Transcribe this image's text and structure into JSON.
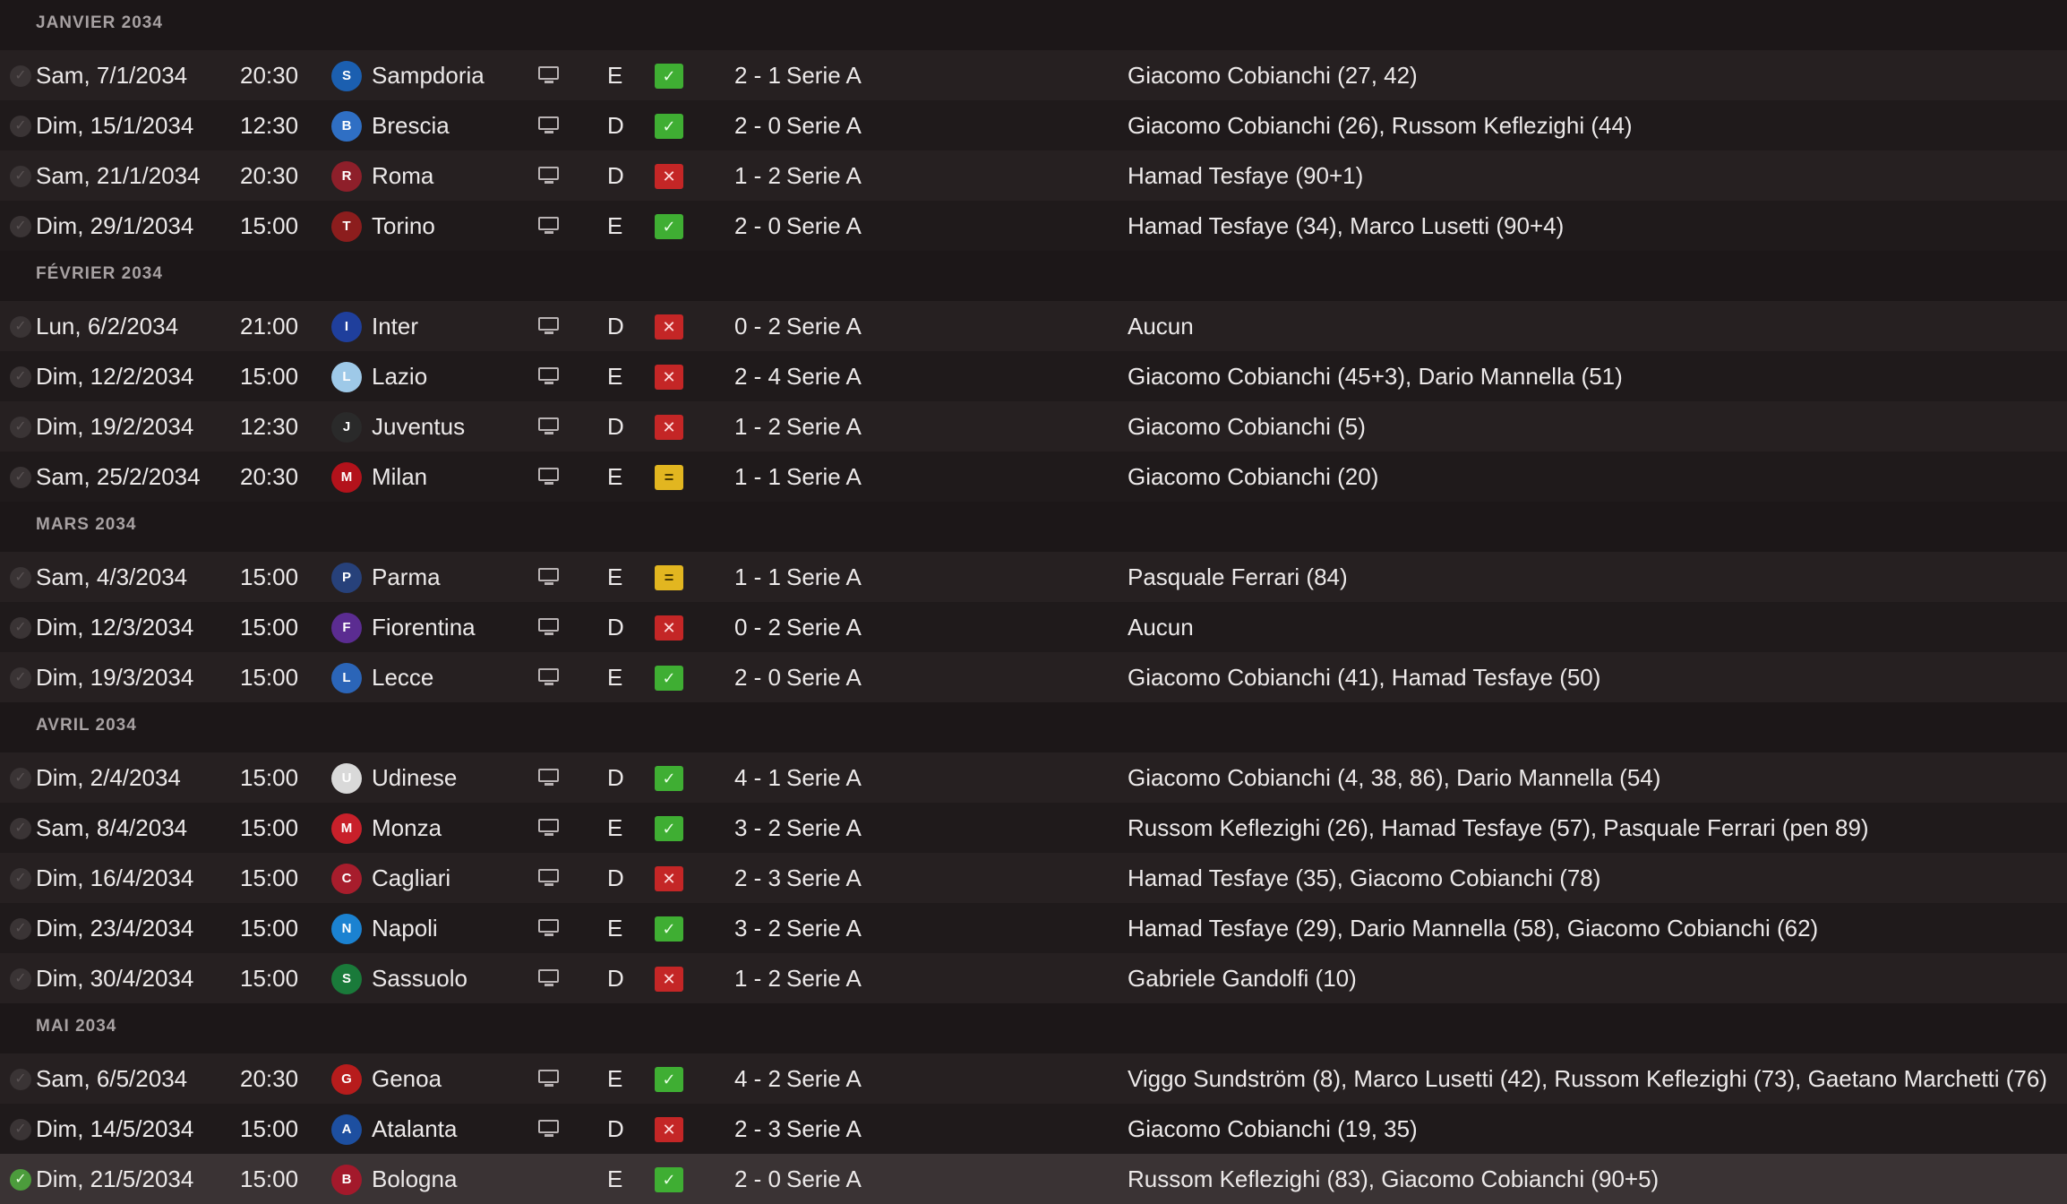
{
  "months": [
    {
      "label": "JANVIER 2034",
      "matches": [
        {
          "date": "Sam, 7/1/2034",
          "time": "20:30",
          "team": "Sampdoria",
          "crest_color": "#1b5fb0",
          "crest_glyph": "S",
          "tv": true,
          "venue": "E",
          "result": "w",
          "result_glyph": "✓",
          "score": "2 - 1",
          "competition": "Serie A",
          "scorers": "Giacomo Cobianchi (27, 42)"
        },
        {
          "date": "Dim, 15/1/2034",
          "time": "12:30",
          "team": "Brescia",
          "crest_color": "#2f6fc4",
          "crest_glyph": "B",
          "tv": true,
          "venue": "D",
          "result": "w",
          "result_glyph": "✓",
          "score": "2 - 0",
          "competition": "Serie A",
          "scorers": "Giacomo Cobianchi (26), Russom Keflezighi (44)"
        },
        {
          "date": "Sam, 21/1/2034",
          "time": "20:30",
          "team": "Roma",
          "crest_color": "#8e1f2a",
          "crest_glyph": "R",
          "tv": true,
          "venue": "D",
          "result": "l",
          "result_glyph": "✕",
          "score": "1 - 2",
          "competition": "Serie A",
          "scorers": "Hamad Tesfaye (90+1)"
        },
        {
          "date": "Dim, 29/1/2034",
          "time": "15:00",
          "team": "Torino",
          "crest_color": "#8c1d1d",
          "crest_glyph": "T",
          "tv": true,
          "venue": "E",
          "result": "w",
          "result_glyph": "✓",
          "score": "2 - 0",
          "competition": "Serie A",
          "scorers": "Hamad Tesfaye (34), Marco Lusetti (90+4)"
        }
      ]
    },
    {
      "label": "FÉVRIER 2034",
      "matches": [
        {
          "date": "Lun, 6/2/2034",
          "time": "21:00",
          "team": "Inter",
          "crest_color": "#1f3f9c",
          "crest_glyph": "I",
          "tv": true,
          "venue": "D",
          "result": "l",
          "result_glyph": "✕",
          "score": "0 - 2",
          "competition": "Serie A",
          "scorers": "Aucun"
        },
        {
          "date": "Dim, 12/2/2034",
          "time": "15:00",
          "team": "Lazio",
          "crest_color": "#9ec9e8",
          "crest_glyph": "L",
          "tv": true,
          "venue": "E",
          "result": "l",
          "result_glyph": "✕",
          "score": "2 - 4",
          "competition": "Serie A",
          "scorers": "Giacomo Cobianchi (45+3), Dario Mannella (51)"
        },
        {
          "date": "Dim, 19/2/2034",
          "time": "12:30",
          "team": "Juventus",
          "crest_color": "#2a2a2a",
          "crest_glyph": "J",
          "tv": true,
          "venue": "D",
          "result": "l",
          "result_glyph": "✕",
          "score": "1 - 2",
          "competition": "Serie A",
          "scorers": "Giacomo Cobianchi (5)"
        },
        {
          "date": "Sam, 25/2/2034",
          "time": "20:30",
          "team": "Milan",
          "crest_color": "#b3121b",
          "crest_glyph": "M",
          "tv": true,
          "venue": "E",
          "result": "d",
          "result_glyph": "=",
          "score": "1 - 1",
          "competition": "Serie A",
          "scorers": "Giacomo Cobianchi (20)"
        }
      ]
    },
    {
      "label": "MARS 2034",
      "matches": [
        {
          "date": "Sam, 4/3/2034",
          "time": "15:00",
          "team": "Parma",
          "crest_color": "#27417a",
          "crest_glyph": "P",
          "tv": true,
          "venue": "E",
          "result": "d",
          "result_glyph": "=",
          "score": "1 - 1",
          "competition": "Serie A",
          "scorers": "Pasquale Ferrari (84)"
        },
        {
          "date": "Dim, 12/3/2034",
          "time": "15:00",
          "team": "Fiorentina",
          "crest_color": "#5b2c91",
          "crest_glyph": "F",
          "tv": true,
          "venue": "D",
          "result": "l",
          "result_glyph": "✕",
          "score": "0 - 2",
          "competition": "Serie A",
          "scorers": "Aucun"
        },
        {
          "date": "Dim, 19/3/2034",
          "time": "15:00",
          "team": "Lecce",
          "crest_color": "#2b65b8",
          "crest_glyph": "L",
          "tv": true,
          "venue": "E",
          "result": "w",
          "result_glyph": "✓",
          "score": "2 - 0",
          "competition": "Serie A",
          "scorers": "Giacomo Cobianchi (41), Hamad Tesfaye (50)"
        }
      ]
    },
    {
      "label": "AVRIL 2034",
      "matches": [
        {
          "date": "Dim, 2/4/2034",
          "time": "15:00",
          "team": "Udinese",
          "crest_color": "#d9d9d9",
          "crest_glyph": "U",
          "tv": true,
          "venue": "D",
          "result": "w",
          "result_glyph": "✓",
          "score": "4 - 1",
          "competition": "Serie A",
          "scorers": "Giacomo Cobianchi (4, 38, 86), Dario Mannella (54)"
        },
        {
          "date": "Sam, 8/4/2034",
          "time": "15:00",
          "team": "Monza",
          "crest_color": "#c8202a",
          "crest_glyph": "M",
          "tv": true,
          "venue": "E",
          "result": "w",
          "result_glyph": "✓",
          "score": "3 - 2",
          "competition": "Serie A",
          "scorers": "Russom Keflezighi (26), Hamad Tesfaye (57), Pasquale Ferrari (pen 89)"
        },
        {
          "date": "Dim, 16/4/2034",
          "time": "15:00",
          "team": "Cagliari",
          "crest_color": "#a71d2c",
          "crest_glyph": "C",
          "tv": true,
          "venue": "D",
          "result": "l",
          "result_glyph": "✕",
          "score": "2 - 3",
          "competition": "Serie A",
          "scorers": "Hamad Tesfaye (35), Giacomo Cobianchi (78)"
        },
        {
          "date": "Dim, 23/4/2034",
          "time": "15:00",
          "team": "Napoli",
          "crest_color": "#1b82d1",
          "crest_glyph": "N",
          "tv": true,
          "venue": "E",
          "result": "w",
          "result_glyph": "✓",
          "score": "3 - 2",
          "competition": "Serie A",
          "scorers": "Hamad Tesfaye (29), Dario Mannella (58), Giacomo Cobianchi (62)"
        },
        {
          "date": "Dim, 30/4/2034",
          "time": "15:00",
          "team": "Sassuolo",
          "crest_color": "#1a7a3a",
          "crest_glyph": "S",
          "tv": true,
          "venue": "D",
          "result": "l",
          "result_glyph": "✕",
          "score": "1 - 2",
          "competition": "Serie A",
          "scorers": "Gabriele Gandolfi (10)"
        }
      ]
    },
    {
      "label": "MAI 2034",
      "matches": [
        {
          "date": "Sam, 6/5/2034",
          "time": "20:30",
          "team": "Genoa",
          "crest_color": "#b71c1c",
          "crest_glyph": "G",
          "tv": true,
          "venue": "E",
          "result": "w",
          "result_glyph": "✓",
          "score": "4 - 2",
          "competition": "Serie A",
          "scorers": "Viggo Sundström (8), Marco Lusetti (42), Russom Keflezighi (73), Gaetano Marchetti (76)"
        },
        {
          "date": "Dim, 14/5/2034",
          "time": "15:00",
          "team": "Atalanta",
          "crest_color": "#1d4fa0",
          "crest_glyph": "A",
          "tv": true,
          "venue": "D",
          "result": "l",
          "result_glyph": "✕",
          "score": "2 - 3",
          "competition": "Serie A",
          "scorers": "Giacomo Cobianchi (19, 35)"
        },
        {
          "date": "Dim, 21/5/2034",
          "time": "15:00",
          "team": "Bologna",
          "crest_color": "#a3192b",
          "crest_glyph": "B",
          "tv": false,
          "venue": "E",
          "result": "w",
          "result_glyph": "✓",
          "score": "2 - 0",
          "competition": "Serie A",
          "scorers": "Russom Keflezighi (83), Giacomo Cobianchi (90+5)",
          "selected": true
        }
      ]
    }
  ]
}
